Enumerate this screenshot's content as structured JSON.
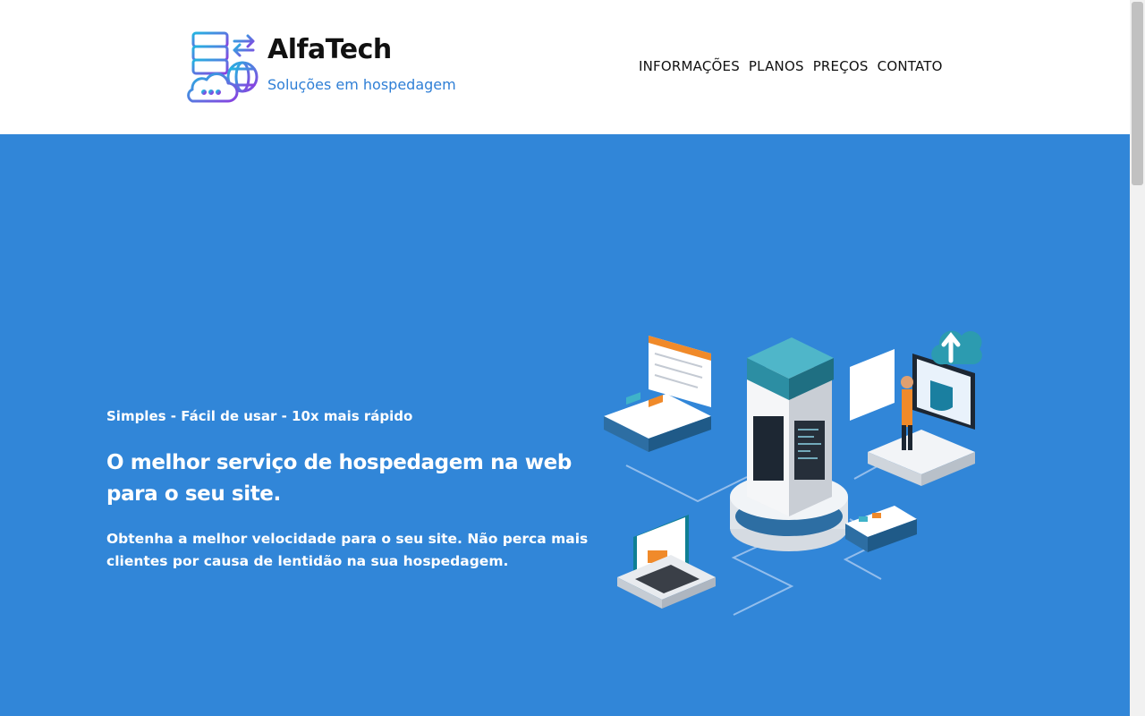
{
  "header": {
    "brand_name": "AlfaTech",
    "brand_tagline": "Soluções em hospedagem",
    "logo_icon": "server-cloud-globe-icon",
    "nav": [
      {
        "label": "INFORMAÇÕES"
      },
      {
        "label": "PLANOS"
      },
      {
        "label": "PREÇOS"
      },
      {
        "label": "CONTATO"
      }
    ]
  },
  "hero": {
    "eyebrow": "Simples - Fácil de usar - 10x mais rápido",
    "headline": "O melhor serviço de hospedagem na web para o seu site.",
    "subtext": "Obtenha a melhor velocidade para o seu site. Não perca mais clientes por causa de lentidão na sua hospedagem.",
    "illustration_icon": "isometric-server-network-illustration"
  },
  "colors": {
    "hero_bg": "#3186d8",
    "brand_accent": "#2f7fd6",
    "logo_gradient_start": "#22b5e0",
    "logo_gradient_end": "#8a3fe0"
  }
}
